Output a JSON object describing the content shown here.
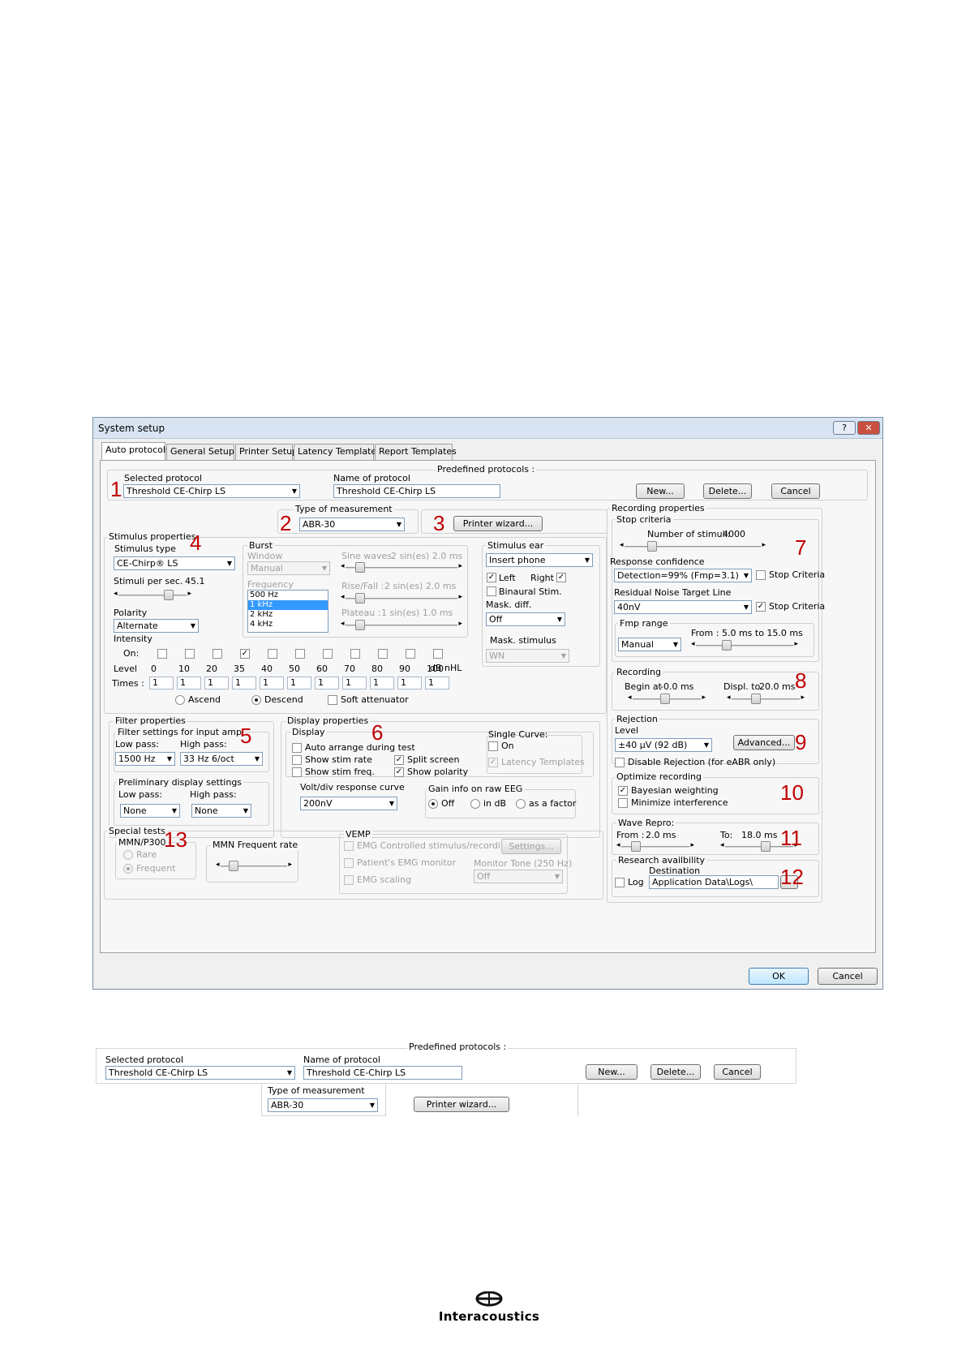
{
  "window": {
    "title": "System setup",
    "help_button": "?",
    "close_button": "✕",
    "tabs": [
      "Auto protocols",
      "General Setup",
      "Printer Setup",
      "Latency Template",
      "Report Templates"
    ],
    "ok": "OK",
    "cancel": "Cancel"
  },
  "protocol": {
    "selected_label": "Selected protocol",
    "selected_value": "Threshold CE-Chirp LS",
    "name_label": "Name of protocol",
    "name_value": "Threshold CE-Chirp LS",
    "predefined_label": "Predefined protocols :",
    "new_btn": "New...",
    "delete_btn": "Delete...",
    "cancel_btn": "Cancel"
  },
  "measurement": {
    "type_label": "Type of measurement",
    "type_value": "ABR-30",
    "printer_wizard": "Printer wizard..."
  },
  "stimulus": {
    "group_label": "Stimulus properties",
    "type_label": "Stimulus type",
    "type_value": "CE-Chirp® LS",
    "rate_label": "Stimuli per sec.",
    "rate_value": "45.1",
    "polarity_label": "Polarity",
    "polarity_value": "Alternate",
    "burst": {
      "label": "Burst",
      "window_label": "Window",
      "window_value": "Manual",
      "frequency_label": "Frequency",
      "frequencies": [
        "500 Hz",
        "1 kHz",
        "2 kHz",
        "4 kHz"
      ],
      "sine_label": "Sine waves",
      "sine_value": "2 sin(es) 2.0 ms",
      "rise_label": "Rise/Fall :",
      "rise_value": "2 sin(es) 2.0 ms",
      "plateau_label": "Plateau :",
      "plateau_value": "1 sin(es) 1.0 ms"
    },
    "intensity": {
      "label": "Intensity",
      "on_label": "On:",
      "level_label": "Level",
      "times_label": "Times :",
      "levels": [
        "0",
        "10",
        "20",
        "35",
        "40",
        "50",
        "60",
        "70",
        "80",
        "90",
        "100"
      ],
      "times": [
        "1",
        "1",
        "1",
        "1",
        "1",
        "1",
        "1",
        "1",
        "1",
        "1",
        "1"
      ],
      "checked": [
        false,
        false,
        false,
        true,
        false,
        false,
        false,
        false,
        false,
        false,
        false
      ],
      "unit": "dB nHL",
      "ascend": "Ascend",
      "descend": "Descend",
      "soft_attenuator": "Soft attenuator"
    },
    "ear": {
      "label": "Stimulus ear",
      "value": "Insert phone",
      "left": "Left",
      "right": "Right",
      "binaural": "Binaural Stim.",
      "mask_diff_label": "Mask. diff.",
      "mask_diff_value": "Off",
      "mask_stim_label": "Mask. stimulus",
      "mask_stim_value": "WN"
    }
  },
  "filter": {
    "label": "Filter properties",
    "input_label": "Filter settings for input amp",
    "low_label": "Low pass:",
    "low_value": "1500 Hz",
    "high_label": "High pass:",
    "high_value": "33 Hz 6/oct",
    "prelim_label": "Preliminary display settings",
    "prelim_low_label": "Low pass:",
    "prelim_low_value": "None",
    "prelim_high_label": "High pass:",
    "prelim_high_value": "None"
  },
  "display": {
    "label": "Display properties",
    "sub_label": "Display",
    "auto_arrange": "Auto arrange during test",
    "show_rate": "Show stim rate",
    "show_freq": "Show stim freq.",
    "split_screen": "Split screen",
    "show_polarity": "Show polarity",
    "single_curve_label": "Single Curve:",
    "single_on": "On",
    "latency_templates": "Latency Templates",
    "volt_label": "Volt/div response curve",
    "volt_value": "200nV",
    "gain_label": "Gain info on raw EEG",
    "gain_off": "Off",
    "gain_db": "in dB",
    "gain_factor": "as a factor"
  },
  "special": {
    "label": "Special tests",
    "mmn_label": "MMN/P300",
    "rare": "Rare",
    "frequent": "Frequent",
    "rate_label": "MMN Frequent rate",
    "vemp_label": "VEMP",
    "emg_controlled": "EMG Controlled stimulus/recording",
    "settings_btn": "Settings...",
    "emg_monitor": "Patient's EMG monitor",
    "monitor_tone_label": "Monitor Tone (250 Hz)",
    "monitor_tone_value": "Off",
    "emg_scaling": "EMG scaling"
  },
  "recording_props": {
    "label": "Recording properties",
    "stop_label": "Stop criteria",
    "stimuli_label": "Number of stimuli:",
    "stimuli_value": "4000",
    "resp_conf_label": "Response confidence",
    "resp_conf_value": "Detection=99% (Fmp=3.1)",
    "stop_criteria": "Stop Criteria",
    "residual_label": "Residual Noise Target Line",
    "residual_value": "40nV",
    "fmp_label": "Fmp range",
    "fmp_mode": "Manual",
    "fmp_range": "From : 5.0 ms to 15.0 ms",
    "recording_label": "Recording",
    "begin_label": "Begin at",
    "begin_value": "-0.0 ms",
    "displ_label": "Displ. to",
    "displ_value": "20.0 ms",
    "rejection_label": "Rejection",
    "level_label": "Level",
    "level_value": "±40 µV (92 dB)",
    "advanced_btn": "Advanced...",
    "disable_rejection": "Disable Rejection (for eABR only)",
    "optimize_label": "Optimize recording",
    "bayesian": "Bayesian weighting",
    "minimize": "Minimize interference",
    "wave_label": "Wave Repro:",
    "wave_from_label": "From :",
    "wave_from_value": "2.0 ms",
    "wave_to_label": "To:",
    "wave_to_value": "18.0 ms",
    "research_label": "Research availbility",
    "destination_label": "Destination",
    "log_label": "Log",
    "log_path": "Application Data\\Logs\\"
  },
  "annotations": [
    "1",
    "2",
    "3",
    "4",
    "5",
    "6",
    "7",
    "8",
    "9",
    "10",
    "11",
    "12",
    "13"
  ],
  "crop": {
    "selected_label": "Selected protocol",
    "selected_value": "Threshold CE-Chirp LS",
    "name_label": "Name of protocol",
    "name_value": "Threshold CE-Chirp LS",
    "predefined_label": "Predefined protocols :",
    "new_btn": "New...",
    "delete_btn": "Delete...",
    "cancel_btn": "Cancel",
    "type_label": "Type of measurement",
    "type_value": "ABR-30",
    "printer_wizard": "Printer wizard..."
  },
  "footer": {
    "brand": "Interacoustics",
    "logo_icon": "interacoustics-logo-icon"
  },
  "colors": {
    "annotation": "#c00000",
    "titlebar": "#d8e4f2",
    "selection": "#3399ff"
  }
}
